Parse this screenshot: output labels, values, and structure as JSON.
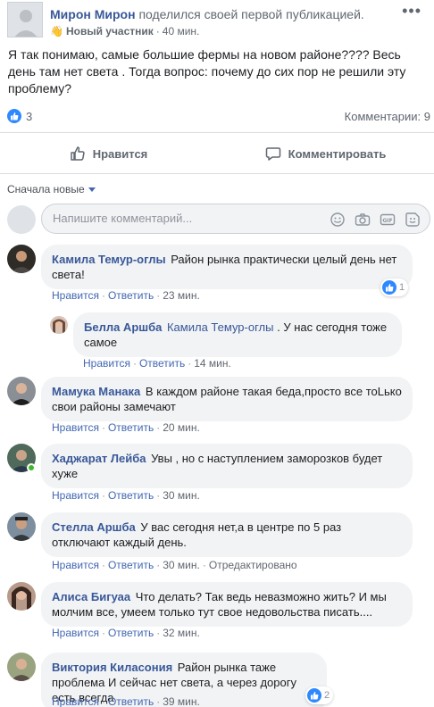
{
  "post": {
    "author": "Мирон Мирон",
    "action": "поделился своей первой публикацией.",
    "badge": "Новый участник",
    "time": "40 мин.",
    "more_label": "•••",
    "text": "Я так понимаю, самые большие фермы на новом районе???? Весь день там нет света . Тогда вопрос: почему до сих пор не решили эту проблему?",
    "likes_count": "3",
    "comments_count": "Комментарии: 9"
  },
  "actions": {
    "like": "Нравится",
    "comment": "Комментировать"
  },
  "sort": {
    "label": "Сначала новые"
  },
  "composer": {
    "placeholder": "Напишите комментарий..."
  },
  "comment_actions": {
    "like": "Нравится",
    "reply": "Ответить",
    "edited": "Отредактировано"
  },
  "comments": [
    {
      "name": "Камила Темур-оглы",
      "text": "Район рынка практически целый день нет света!",
      "time": "23 мин.",
      "reactions": "1"
    },
    {
      "name": "Белла Аршба",
      "mention": "Камила Темур-оглы",
      "text": ". У нас сегодня тоже самое",
      "time": "14 мин."
    },
    {
      "name": "Мамука Манака",
      "text": "В каждом районе такая беда,просто все тоLько свои районы замечают",
      "time": "20 мин."
    },
    {
      "name": "Хаджарат Лейба",
      "text": "Увы , но с наступлением заморозков будет хуже",
      "time": "30 мин."
    },
    {
      "name": "Стелла Аршба",
      "text": "У вас сегодня нет,а в центре по 5 раз отключают каждый день.",
      "time": "30 мин."
    },
    {
      "name": "Алиса Бигуаа",
      "text": "Что делать? Так ведь невазможно жить? И мы молчим все, умеем только тут свое недовольства писать....",
      "time": "32 мин."
    },
    {
      "name": "Виктория Киласония",
      "text": "Район рынка таже проблема И сейчас нет света, а через дорогу есть всегда",
      "time": "39 мин.",
      "reactions": "2"
    }
  ],
  "colors": {
    "link": "#385898",
    "action_link": "#4267b2",
    "bubble_bg": "#f2f3f5",
    "like_blue": "#2e89ff",
    "online_green": "#42b72a"
  }
}
